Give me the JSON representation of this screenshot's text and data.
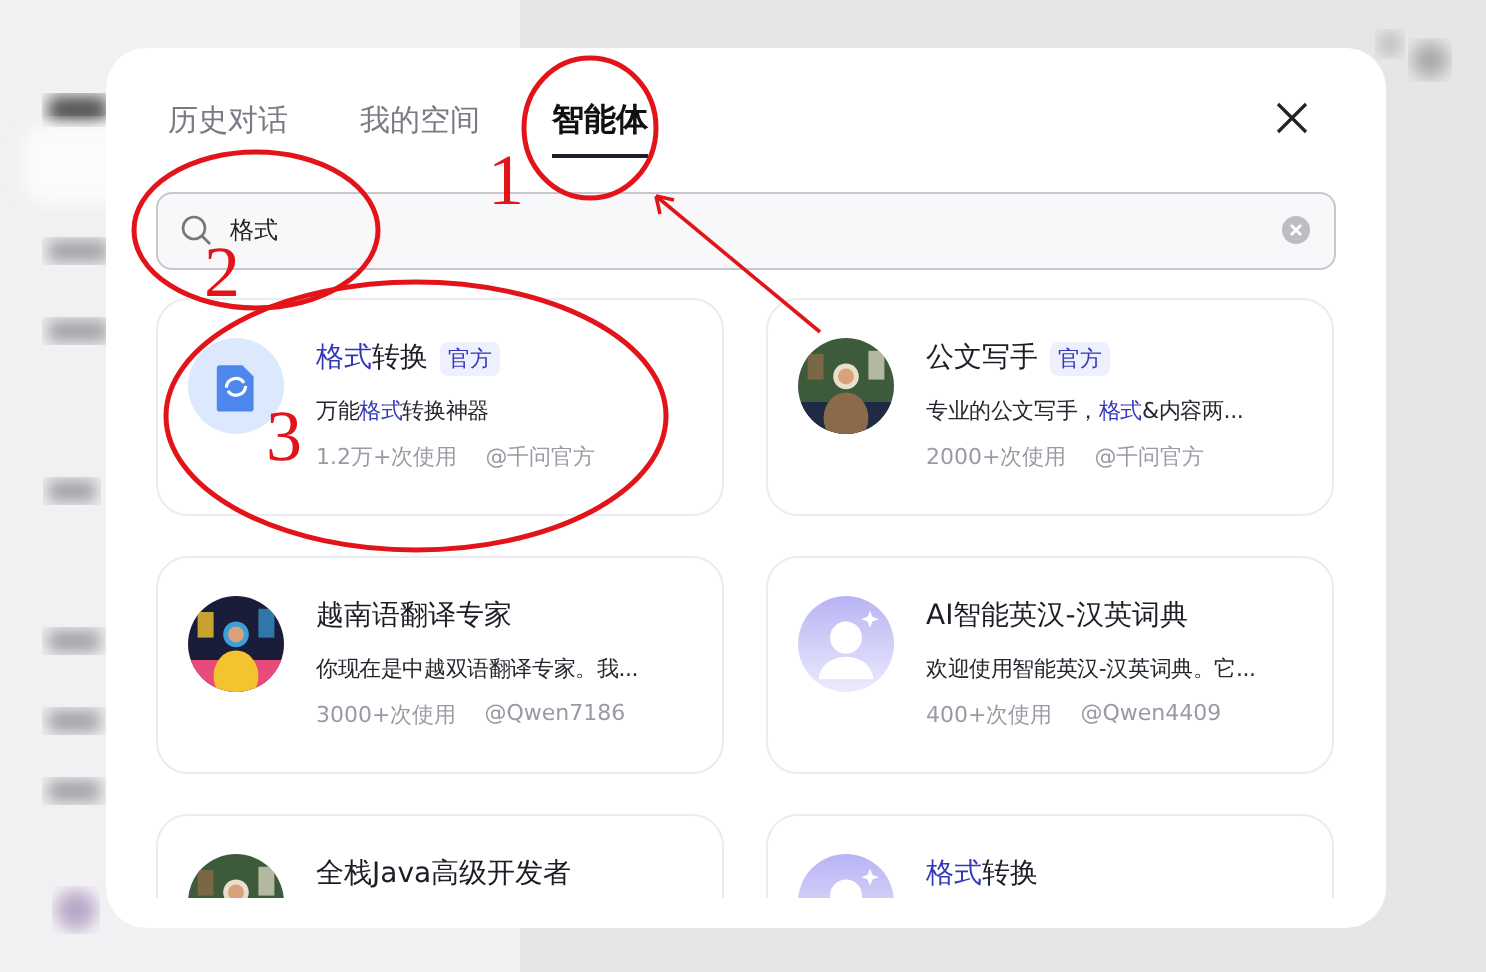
{
  "tabs": [
    {
      "label": "历史对话",
      "selected": false
    },
    {
      "label": "我的空间",
      "selected": false
    },
    {
      "label": "智能体",
      "selected": true
    }
  ],
  "search": {
    "value": "格式"
  },
  "agents": [
    {
      "avatar": {
        "kind": "doc"
      },
      "title": "**格式**转换",
      "badge": "官方",
      "description": "万能**格式**转换神器",
      "usage": "1.2万+次使用",
      "author": "@千问官方"
    },
    {
      "title": "公文写手",
      "badge": "官方",
      "description": "专业的公文写手，**格式**&内容两...",
      "usage": "2000+次使用",
      "author": "@千问官方"
    },
    {
      "title": "越南语翻译专家",
      "description": "你现在是中越双语翻译专家。我...",
      "usage": "3000+次使用",
      "author": "@Qwen7186"
    },
    {
      "avatar": {
        "kind": "default"
      },
      "title": "AI智能英汉-汉英词典",
      "description": "欢迎使用智能英汉-汉英词典。它...",
      "usage": "400+次使用",
      "author": "@Qwen4409"
    },
    {
      "title": "全栈Java高级开发者"
    },
    {
      "avatar": {
        "kind": "default"
      },
      "title": "**格式**转换"
    }
  ],
  "annotations": [
    {
      "label": "1"
    },
    {
      "label": "2"
    },
    {
      "label": "3"
    }
  ]
}
